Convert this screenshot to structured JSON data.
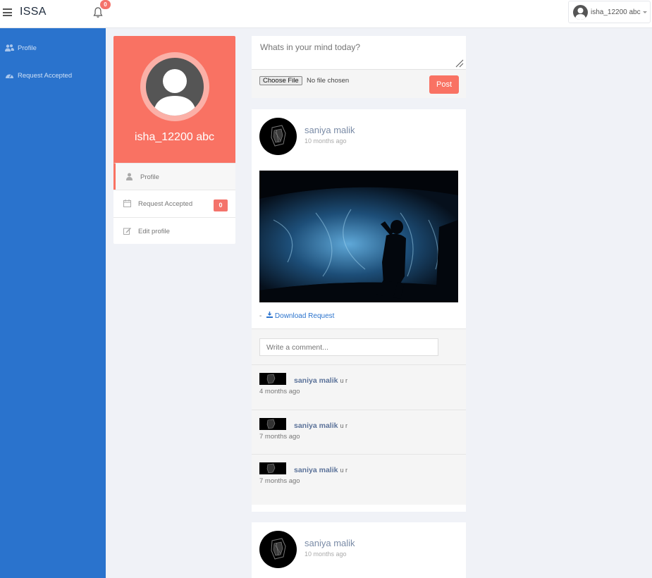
{
  "app": {
    "brand": "ISSA"
  },
  "header": {
    "notification_count": "0",
    "user_name": "isha_12200 abc"
  },
  "sidebar": {
    "items": [
      {
        "label": "Profile",
        "icon": "users-icon"
      },
      {
        "label": "Request Accepted",
        "icon": "dashboard-icon"
      }
    ]
  },
  "profile": {
    "name": "isha_12200 abc",
    "menu": [
      {
        "label": "Profile",
        "icon": "user-icon"
      },
      {
        "label": "Request Accepted",
        "icon": "calendar-icon",
        "badge": "0"
      },
      {
        "label": "Edit profile",
        "icon": "edit-icon"
      }
    ]
  },
  "composer": {
    "placeholder": "Whats in your mind today?",
    "choose_file_label": "Choose File",
    "no_file_text": "No file chosen",
    "post_label": "Post"
  },
  "posts": [
    {
      "author": "saniya malik",
      "time": "10 months ago",
      "download_label": "Download Request",
      "comment_placeholder": "Write a comment...",
      "comments": [
        {
          "author": "saniya malik",
          "text": "u r",
          "time": "4 months ago"
        },
        {
          "author": "saniya malik",
          "text": "u r",
          "time": "7 months ago"
        },
        {
          "author": "saniya malik",
          "text": "u r",
          "time": "7 months ago"
        }
      ]
    },
    {
      "author": "saniya malik",
      "time": "10 months ago"
    }
  ],
  "colors": {
    "sidebar": "#2a73cd",
    "accent": "#f97263",
    "badge": "#f4736b",
    "author_text": "#7a8ba6"
  }
}
